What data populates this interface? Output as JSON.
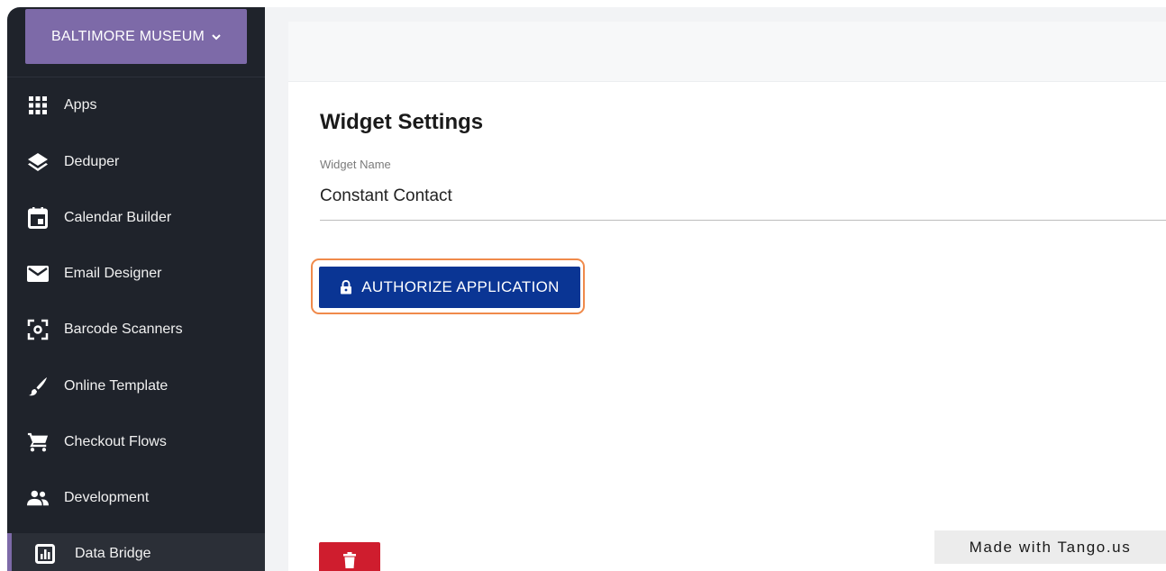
{
  "sidebar": {
    "org_label": "BALTIMORE MUSEUM",
    "items": [
      {
        "label": "Apps",
        "icon": "apps-grid-icon"
      },
      {
        "label": "Deduper",
        "icon": "layers-icon"
      },
      {
        "label": "Calendar Builder",
        "icon": "calendar-icon"
      },
      {
        "label": "Email Designer",
        "icon": "envelope-icon"
      },
      {
        "label": "Barcode Scanners",
        "icon": "barcode-scanner-icon"
      },
      {
        "label": "Online Template",
        "icon": "brush-icon"
      },
      {
        "label": "Checkout Flows",
        "icon": "cart-icon"
      },
      {
        "label": "Development",
        "icon": "people-icon"
      },
      {
        "label": "Data Bridge",
        "icon": "bar-chart-icon",
        "active": true
      }
    ]
  },
  "main": {
    "title": "Widget Settings",
    "widget_name_label": "Widget Name",
    "widget_name_value": "Constant Contact",
    "authorize_label": "AUTHORIZE APPLICATION"
  },
  "watermark": "Made with Tango.us",
  "colors": {
    "sidebar_bg": "#1f232b",
    "org_button": "#7d6aa8",
    "authorize_button": "#0a3594",
    "highlight": "#f08a4b",
    "delete_button": "#cf1d2e"
  }
}
